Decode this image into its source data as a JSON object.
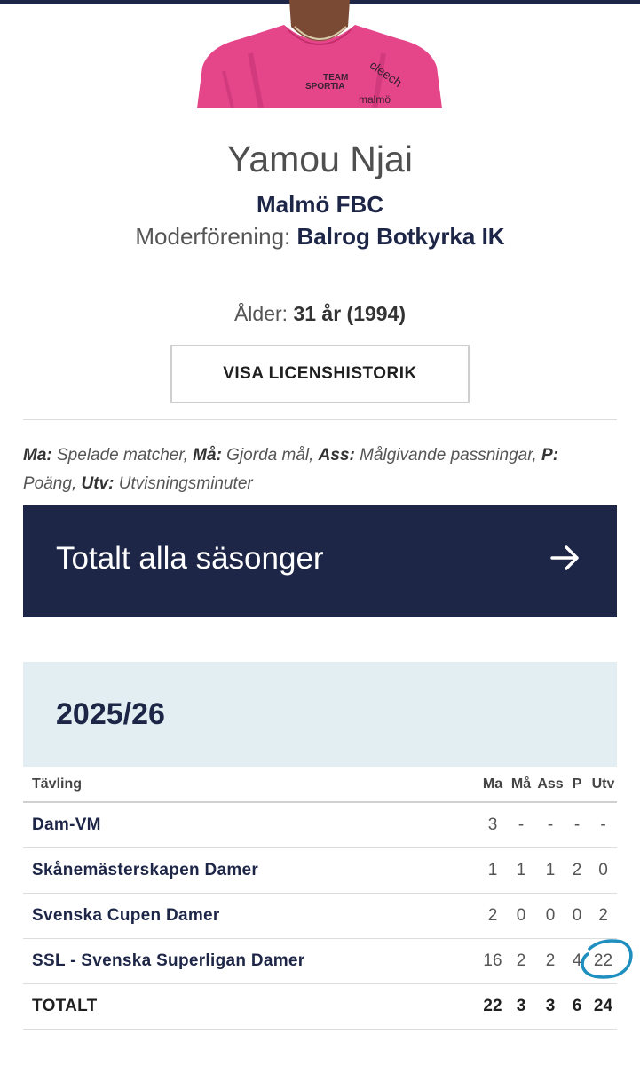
{
  "player": {
    "name": "Yamou Njai",
    "club": "Malmö FBC",
    "home_club_label": "Moderförening:",
    "home_club": "Balrog Botkyrka IK",
    "age_label": "Ålder:",
    "age_value": "31 år (1994)",
    "shirt_text_1": "TEAM",
    "shirt_text_2": "SPORTIA",
    "shirt_text_3": "cleech",
    "shirt_text_4": "malmö"
  },
  "buttons": {
    "license_history": "VISA LICENSHISTORIK"
  },
  "legend": {
    "ma_key": "Ma:",
    "ma_text": " Spelade matcher, ",
    "ma2_key": "Må:",
    "ma2_text": " Gjorda mål, ",
    "ass_key": "Ass:",
    "ass_text": " Målgivande passningar, ",
    "p_key": "P:",
    "p_text": " Poäng, ",
    "utv_key": "Utv:",
    "utv_text": " Utvisningsminuter"
  },
  "total_seasons": {
    "label": "Totalt alla säsonger",
    "icon": "arrow-right-icon"
  },
  "season": {
    "label": "2025/26"
  },
  "stats_table": {
    "headers": {
      "competition": "Tävling",
      "ma": "Ma",
      "ma2": "Må",
      "ass": "Ass",
      "p": "P",
      "utv": "Utv"
    },
    "rows": [
      {
        "competition": "Dam-VM",
        "ma": "3",
        "ma2": "-",
        "ass": "-",
        "p": "-",
        "utv": "-"
      },
      {
        "competition": "Skånemästerskapen Damer",
        "ma": "1",
        "ma2": "1",
        "ass": "1",
        "p": "2",
        "utv": "0"
      },
      {
        "competition": "Svenska Cupen Damer",
        "ma": "2",
        "ma2": "0",
        "ass": "0",
        "p": "0",
        "utv": "2"
      },
      {
        "competition": "SSL - Svenska Superligan Damer",
        "ma": "16",
        "ma2": "2",
        "ass": "2",
        "p": "4",
        "utv": "22"
      }
    ],
    "total": {
      "competition": "TOTALT",
      "ma": "22",
      "ma2": "3",
      "ass": "3",
      "p": "6",
      "utv": "24"
    }
  },
  "colors": {
    "navy": "#1e2647",
    "season_bg": "#e3eef2",
    "shirt_pink": "#e5468a",
    "annotation_blue": "#1f8fbf"
  }
}
